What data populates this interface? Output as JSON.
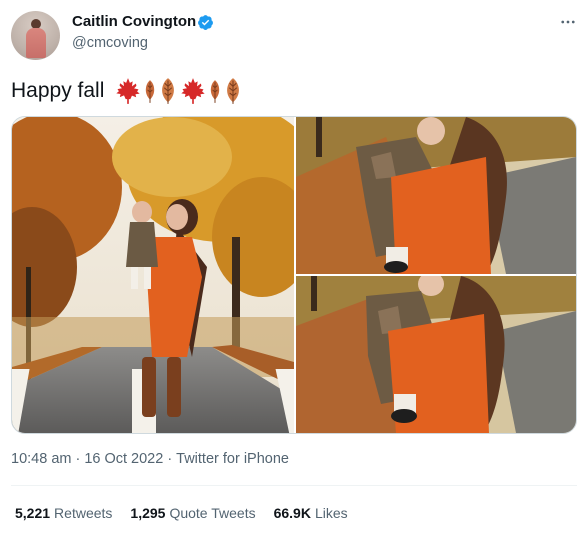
{
  "author": {
    "name": "Caitlin Covington",
    "handle": "@cmcoving",
    "verified": true
  },
  "tweet": {
    "text": "Happy fall",
    "emojis": [
      "maple-leaf",
      "fallen-leaf",
      "fallen-leaf",
      "maple-leaf",
      "fallen-leaf",
      "fallen-leaf"
    ]
  },
  "meta": {
    "time": "10:48 am",
    "separator1": "·",
    "date": "16 Oct 2022",
    "separator2": "·",
    "source": "Twitter for iPhone"
  },
  "stats": {
    "retweets": {
      "count": "5,221",
      "label": "Retweets"
    },
    "quotes": {
      "count": "1,295",
      "label": "Quote Tweets"
    },
    "likes": {
      "count": "66.9K",
      "label": "Likes"
    }
  },
  "colors": {
    "primary_text": "#0f1419",
    "secondary_text": "#536471",
    "verified_blue": "#1d9bf0",
    "maple_red": "#d62828",
    "leaf_orange": "#c8693a",
    "dress_orange": "#e2611f"
  },
  "icons": {
    "more": "more-horizontal-icon",
    "verified": "verified-badge-icon"
  }
}
